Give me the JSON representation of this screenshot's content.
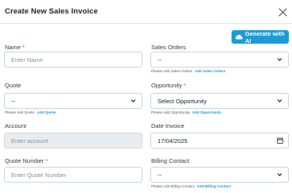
{
  "modal": {
    "title": "Create New Sales Invoice",
    "close_icon": "close-icon"
  },
  "ai_button": {
    "label": "Generate with AI",
    "icon": "cloud-ai-icon",
    "color": "#1e9bd7"
  },
  "fields": {
    "name": {
      "label": "Name",
      "required": "*",
      "placeholder": "Enter Name"
    },
    "sales_orders": {
      "label": "Sales Orders",
      "value": "--",
      "hint": "Please Add Sales Orders.",
      "hint_link": "Add Sales Orders"
    },
    "quote": {
      "label": "Quote",
      "value": "--",
      "hint": "Please Add Quote.",
      "hint_link": "Add Quote"
    },
    "opportunity": {
      "label": "Opportunity",
      "required": "*",
      "value": "Select Opportunity",
      "hint": "Please Add Opportunity.",
      "hint_link": "Add Opportunity"
    },
    "account": {
      "label": "Account",
      "placeholder": "Enter account"
    },
    "date_invoice": {
      "label": "Date Invoice",
      "value": "17/04/2025",
      "icon": "calendar-icon"
    },
    "quote_number": {
      "label": "Quote Number",
      "required": "*",
      "placeholder": "Enter Quote Number"
    },
    "billing_contact": {
      "label": "Billing Contact",
      "value": "--",
      "hint": "Please Add Billing Contact.",
      "hint_link": "Add Billing Contact"
    }
  },
  "colors": {
    "accent": "#1e9bd7",
    "required": "#e0454f",
    "disabled_bg": "#e9ecef"
  }
}
